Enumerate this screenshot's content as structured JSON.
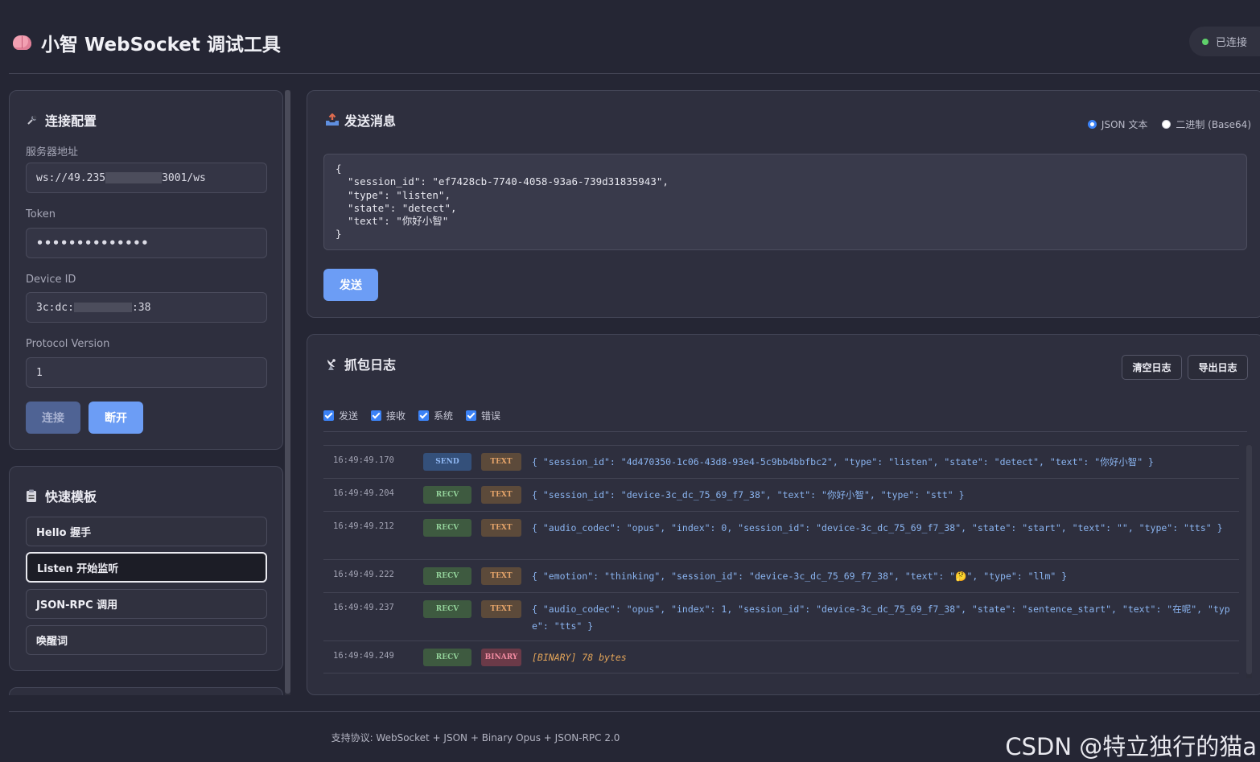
{
  "header": {
    "title": "小智 WebSocket 调试工具",
    "status": "已连接"
  },
  "connection": {
    "title": "连接配置",
    "server_label": "服务器地址",
    "server_prefix": "ws://49.235",
    "server_suffix": "3001/ws",
    "token_label": "Token",
    "token_value": "••••••••••••••",
    "device_label": "Device ID",
    "device_prefix": "3c:dc:",
    "device_suffix": ":38",
    "protocol_label": "Protocol Version",
    "protocol_value": "1",
    "connect_label": "连接",
    "disconnect_label": "断开"
  },
  "templates": {
    "title": "快速模板",
    "items": [
      "Hello 握手",
      "Listen 开始监听",
      "JSON-RPC 调用",
      "唤醒词"
    ]
  },
  "send": {
    "title": "发送消息",
    "mode_json": "JSON 文本",
    "mode_binary": "二进制 (Base64)",
    "message": "{\n  \"session_id\": \"ef7428cb-7740-4058-93a6-739d31835943\",\n  \"type\": \"listen\",\n  \"state\": \"detect\",\n  \"text\": \"你好小智\"\n}",
    "send_label": "发送"
  },
  "log": {
    "title": "抓包日志",
    "clear_label": "清空日志",
    "export_label": "导出日志",
    "filters": [
      "发送",
      "接收",
      "系统",
      "错误"
    ],
    "entries": [
      {
        "time": "16:49:49.170",
        "dir": "SEND",
        "type": "TEXT",
        "msg": "{ \"session_id\": \"4d470350-1c06-43d8-93e4-5c9bb4bbfbc2\", \"type\": \"listen\", \"state\": \"detect\", \"text\": \"你好小智\" }"
      },
      {
        "time": "16:49:49.204",
        "dir": "RECV",
        "type": "TEXT",
        "msg": "{ \"session_id\": \"device-3c_dc_75_69_f7_38\", \"text\": \"你好小智\", \"type\": \"stt\" }"
      },
      {
        "time": "16:49:49.212",
        "dir": "RECV",
        "type": "TEXT",
        "msg": "{ \"audio_codec\": \"opus\", \"index\": 0, \"session_id\": \"device-3c_dc_75_69_f7_38\", \"state\": \"start\", \"text\": \"\", \"type\": \"tts\" }"
      },
      {
        "time": "16:49:49.222",
        "dir": "RECV",
        "type": "TEXT",
        "msg": "{ \"emotion\": \"thinking\", \"session_id\": \"device-3c_dc_75_69_f7_38\", \"text\": \"🤔\", \"type\": \"llm\" }"
      },
      {
        "time": "16:49:49.237",
        "dir": "RECV",
        "type": "TEXT",
        "msg": "{ \"audio_codec\": \"opus\", \"index\": 1, \"session_id\": \"device-3c_dc_75_69_f7_38\", \"state\": \"sentence_start\", \"text\": \"在呢\", \"type\": \"tts\" }"
      },
      {
        "time": "16:49:49.249",
        "dir": "RECV",
        "type": "BINARY",
        "msg": "[BINARY] 78 bytes"
      }
    ]
  },
  "footer": {
    "text": "支持协议: WebSocket + JSON + Binary Opus + JSON-RPC 2.0"
  },
  "watermark": "CSDN @特立独行的猫a",
  "colors": {
    "accent": "#6c9df5",
    "connected": "#5fd16b",
    "background": "#252634"
  }
}
